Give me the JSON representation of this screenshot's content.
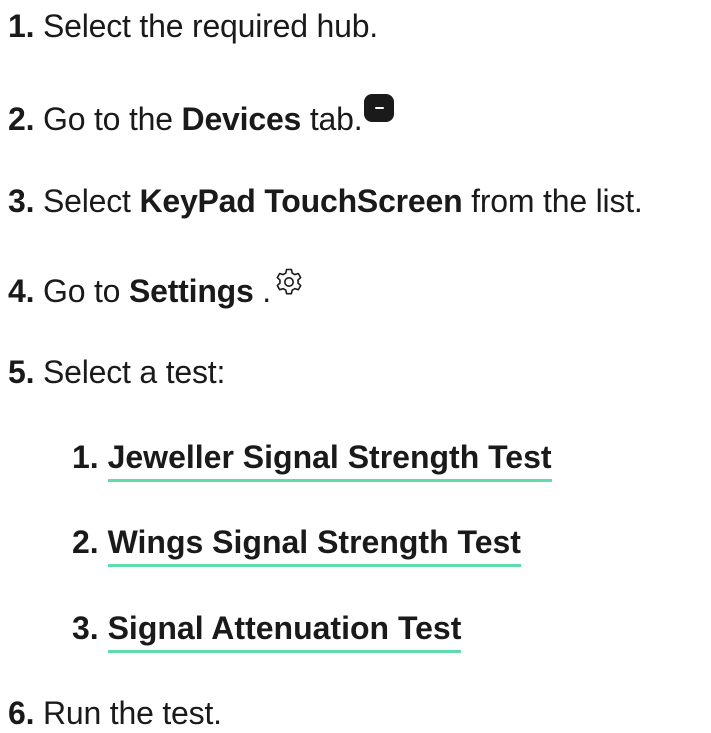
{
  "steps": [
    {
      "num": "1.",
      "pre": "Select the required hub.",
      "bold": "",
      "post": ""
    },
    {
      "num": "2.",
      "pre": "Go to the ",
      "bold": "Devices",
      "post": " tab."
    },
    {
      "num": "3.",
      "pre": "Select ",
      "bold": "KeyPad TouchScreen",
      "post": " from the list."
    },
    {
      "num": "4.",
      "pre": "Go to ",
      "bold": "Settings",
      "post": " ."
    },
    {
      "num": "5.",
      "pre": "Select a test:",
      "bold": "",
      "post": ""
    },
    {
      "num": "6.",
      "pre": "Run the test.",
      "bold": "",
      "post": ""
    }
  ],
  "tests": [
    {
      "num": "1.",
      "label": "Jeweller Signal Strength Test"
    },
    {
      "num": "2.",
      "label": "Wings Signal Strength Test"
    },
    {
      "num": "3.",
      "label": "Signal Attenuation Test"
    }
  ],
  "icons": {
    "devices_tab": "devices-tab-icon",
    "settings": "gear-icon"
  },
  "colors": {
    "text": "#1a1a1a",
    "link_underline": "#5fdcaa"
  }
}
